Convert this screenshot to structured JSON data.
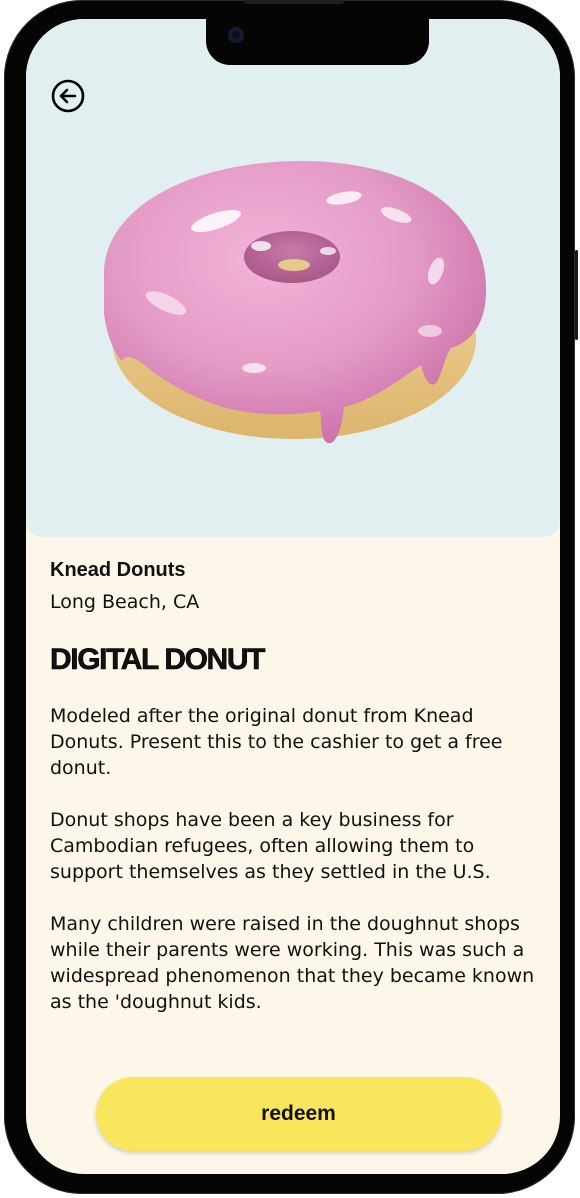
{
  "shop": {
    "name": "Knead Donuts",
    "location": "Long Beach, CA"
  },
  "product": {
    "title": "DIGITAL DONUT",
    "description": [
      "Modeled after the original donut from Knead Donuts. Present this to the cashier to get a free donut.",
      "Donut shops have been a key business for Cambodian refugees, often allowing them to support themselves as they settled in the U.S.",
      "Many children were raised in the doughnut shops while their parents were working. This was such a widespread phenomenon that they became known as the 'doughnut kids."
    ]
  },
  "actions": {
    "redeem_label": "redeem"
  },
  "icons": {
    "back": "arrow-left-circle-icon",
    "hero": "pink-frosted-donut"
  },
  "colors": {
    "hero_background": "#e1eff1",
    "page_background": "#fcf7e8",
    "button": "#f9e65c",
    "frosting": "#e59ac7",
    "dough": "#e8c880"
  }
}
